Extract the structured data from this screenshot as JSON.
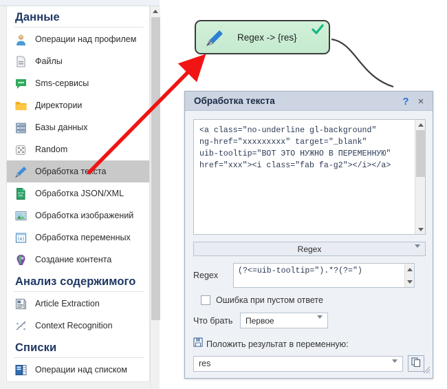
{
  "sidebar": {
    "groups": [
      {
        "title": "Данные",
        "items": [
          {
            "label": "Операции над профилем",
            "icon": "user-icon"
          },
          {
            "label": "Файлы",
            "icon": "file-icon"
          },
          {
            "label": "Sms-сервисы",
            "icon": "chat-bubble-icon"
          },
          {
            "label": "Директории",
            "icon": "folder-icon"
          },
          {
            "label": "Базы данных",
            "icon": "database-icon"
          },
          {
            "label": "Random",
            "icon": "dice-icon"
          },
          {
            "label": "Обработка текста",
            "icon": "pen-icon",
            "selected": true
          },
          {
            "label": "Обработка JSON/XML",
            "icon": "json-xml-icon"
          },
          {
            "label": "Обработка изображений",
            "icon": "image-icon"
          },
          {
            "label": "Обработка переменных",
            "icon": "variable-icon"
          },
          {
            "label": "Создание контента",
            "icon": "brain-icon"
          }
        ]
      },
      {
        "title": "Анализ содержимого",
        "items": [
          {
            "label": "Article Extraction",
            "icon": "article-icon"
          },
          {
            "label": "Context Recognition",
            "icon": "context-icon"
          }
        ]
      },
      {
        "title": "Списки",
        "items": [
          {
            "label": "Операции над списком",
            "icon": "list-icon"
          }
        ]
      }
    ]
  },
  "node": {
    "label": "Regex -> {res}",
    "icon": "pen-icon",
    "status_icon": "check-icon",
    "fill_color": "#c9edd4",
    "border_color": "#3d3d3d"
  },
  "dialog": {
    "title": "Обработка текста",
    "help_label": "?",
    "close_label": "×",
    "source_text": "<a class=\"no-underline gl-background\"\nng-href=\"xxxxxxxxx\" target=\"_blank\"\nuib-tooltip=\"ВОТ ЭТО НУЖНО В ПЕРЕМЕННУЮ\"\nhref=\"xxx\"><i class=\"fab fa-g2\"></i></a>",
    "mode_select": {
      "value": "Regex",
      "options": [
        "Regex"
      ]
    },
    "regex": {
      "label": "Regex",
      "value": "(?<=uib-tooltip=\").*?(?=\")"
    },
    "checkbox": {
      "label": "Ошибка при пустом ответе",
      "checked": false
    },
    "take": {
      "label": "Что брать",
      "value": "Первое",
      "options": [
        "Первое"
      ]
    },
    "result": {
      "label": "Положить результат в переменную:",
      "save_icon": "save-icon",
      "value": "res",
      "copy_icon": "copy-icon"
    }
  },
  "annotation": {
    "arrow_color": "#f01414"
  }
}
